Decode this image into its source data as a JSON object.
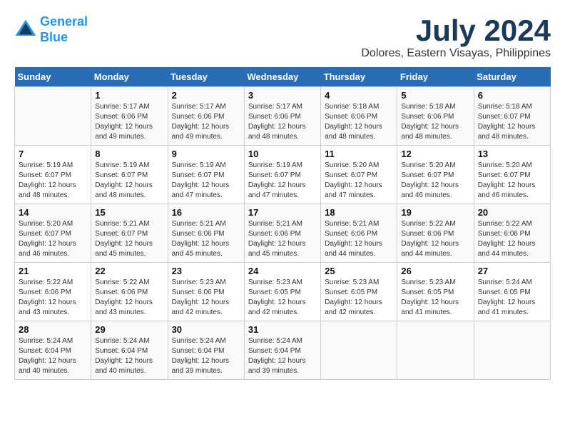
{
  "header": {
    "logo_line1": "General",
    "logo_line2": "Blue",
    "title": "July 2024",
    "subtitle": "Dolores, Eastern Visayas, Philippines"
  },
  "calendar": {
    "days_of_week": [
      "Sunday",
      "Monday",
      "Tuesday",
      "Wednesday",
      "Thursday",
      "Friday",
      "Saturday"
    ],
    "weeks": [
      [
        {
          "day": "",
          "sunrise": "",
          "sunset": "",
          "daylight": ""
        },
        {
          "day": "1",
          "sunrise": "Sunrise: 5:17 AM",
          "sunset": "Sunset: 6:06 PM",
          "daylight": "Daylight: 12 hours and 49 minutes."
        },
        {
          "day": "2",
          "sunrise": "Sunrise: 5:17 AM",
          "sunset": "Sunset: 6:06 PM",
          "daylight": "Daylight: 12 hours and 49 minutes."
        },
        {
          "day": "3",
          "sunrise": "Sunrise: 5:17 AM",
          "sunset": "Sunset: 6:06 PM",
          "daylight": "Daylight: 12 hours and 48 minutes."
        },
        {
          "day": "4",
          "sunrise": "Sunrise: 5:18 AM",
          "sunset": "Sunset: 6:06 PM",
          "daylight": "Daylight: 12 hours and 48 minutes."
        },
        {
          "day": "5",
          "sunrise": "Sunrise: 5:18 AM",
          "sunset": "Sunset: 6:06 PM",
          "daylight": "Daylight: 12 hours and 48 minutes."
        },
        {
          "day": "6",
          "sunrise": "Sunrise: 5:18 AM",
          "sunset": "Sunset: 6:07 PM",
          "daylight": "Daylight: 12 hours and 48 minutes."
        }
      ],
      [
        {
          "day": "7",
          "sunrise": "Sunrise: 5:19 AM",
          "sunset": "Sunset: 6:07 PM",
          "daylight": "Daylight: 12 hours and 48 minutes."
        },
        {
          "day": "8",
          "sunrise": "Sunrise: 5:19 AM",
          "sunset": "Sunset: 6:07 PM",
          "daylight": "Daylight: 12 hours and 48 minutes."
        },
        {
          "day": "9",
          "sunrise": "Sunrise: 5:19 AM",
          "sunset": "Sunset: 6:07 PM",
          "daylight": "Daylight: 12 hours and 47 minutes."
        },
        {
          "day": "10",
          "sunrise": "Sunrise: 5:19 AM",
          "sunset": "Sunset: 6:07 PM",
          "daylight": "Daylight: 12 hours and 47 minutes."
        },
        {
          "day": "11",
          "sunrise": "Sunrise: 5:20 AM",
          "sunset": "Sunset: 6:07 PM",
          "daylight": "Daylight: 12 hours and 47 minutes."
        },
        {
          "day": "12",
          "sunrise": "Sunrise: 5:20 AM",
          "sunset": "Sunset: 6:07 PM",
          "daylight": "Daylight: 12 hours and 46 minutes."
        },
        {
          "day": "13",
          "sunrise": "Sunrise: 5:20 AM",
          "sunset": "Sunset: 6:07 PM",
          "daylight": "Daylight: 12 hours and 46 minutes."
        }
      ],
      [
        {
          "day": "14",
          "sunrise": "Sunrise: 5:20 AM",
          "sunset": "Sunset: 6:07 PM",
          "daylight": "Daylight: 12 hours and 46 minutes."
        },
        {
          "day": "15",
          "sunrise": "Sunrise: 5:21 AM",
          "sunset": "Sunset: 6:07 PM",
          "daylight": "Daylight: 12 hours and 45 minutes."
        },
        {
          "day": "16",
          "sunrise": "Sunrise: 5:21 AM",
          "sunset": "Sunset: 6:06 PM",
          "daylight": "Daylight: 12 hours and 45 minutes."
        },
        {
          "day": "17",
          "sunrise": "Sunrise: 5:21 AM",
          "sunset": "Sunset: 6:06 PM",
          "daylight": "Daylight: 12 hours and 45 minutes."
        },
        {
          "day": "18",
          "sunrise": "Sunrise: 5:21 AM",
          "sunset": "Sunset: 6:06 PM",
          "daylight": "Daylight: 12 hours and 44 minutes."
        },
        {
          "day": "19",
          "sunrise": "Sunrise: 5:22 AM",
          "sunset": "Sunset: 6:06 PM",
          "daylight": "Daylight: 12 hours and 44 minutes."
        },
        {
          "day": "20",
          "sunrise": "Sunrise: 5:22 AM",
          "sunset": "Sunset: 6:06 PM",
          "daylight": "Daylight: 12 hours and 44 minutes."
        }
      ],
      [
        {
          "day": "21",
          "sunrise": "Sunrise: 5:22 AM",
          "sunset": "Sunset: 6:06 PM",
          "daylight": "Daylight: 12 hours and 43 minutes."
        },
        {
          "day": "22",
          "sunrise": "Sunrise: 5:22 AM",
          "sunset": "Sunset: 6:06 PM",
          "daylight": "Daylight: 12 hours and 43 minutes."
        },
        {
          "day": "23",
          "sunrise": "Sunrise: 5:23 AM",
          "sunset": "Sunset: 6:06 PM",
          "daylight": "Daylight: 12 hours and 42 minutes."
        },
        {
          "day": "24",
          "sunrise": "Sunrise: 5:23 AM",
          "sunset": "Sunset: 6:05 PM",
          "daylight": "Daylight: 12 hours and 42 minutes."
        },
        {
          "day": "25",
          "sunrise": "Sunrise: 5:23 AM",
          "sunset": "Sunset: 6:05 PM",
          "daylight": "Daylight: 12 hours and 42 minutes."
        },
        {
          "day": "26",
          "sunrise": "Sunrise: 5:23 AM",
          "sunset": "Sunset: 6:05 PM",
          "daylight": "Daylight: 12 hours and 41 minutes."
        },
        {
          "day": "27",
          "sunrise": "Sunrise: 5:24 AM",
          "sunset": "Sunset: 6:05 PM",
          "daylight": "Daylight: 12 hours and 41 minutes."
        }
      ],
      [
        {
          "day": "28",
          "sunrise": "Sunrise: 5:24 AM",
          "sunset": "Sunset: 6:04 PM",
          "daylight": "Daylight: 12 hours and 40 minutes."
        },
        {
          "day": "29",
          "sunrise": "Sunrise: 5:24 AM",
          "sunset": "Sunset: 6:04 PM",
          "daylight": "Daylight: 12 hours and 40 minutes."
        },
        {
          "day": "30",
          "sunrise": "Sunrise: 5:24 AM",
          "sunset": "Sunset: 6:04 PM",
          "daylight": "Daylight: 12 hours and 39 minutes."
        },
        {
          "day": "31",
          "sunrise": "Sunrise: 5:24 AM",
          "sunset": "Sunset: 6:04 PM",
          "daylight": "Daylight: 12 hours and 39 minutes."
        },
        {
          "day": "",
          "sunrise": "",
          "sunset": "",
          "daylight": ""
        },
        {
          "day": "",
          "sunrise": "",
          "sunset": "",
          "daylight": ""
        },
        {
          "day": "",
          "sunrise": "",
          "sunset": "",
          "daylight": ""
        }
      ]
    ]
  }
}
